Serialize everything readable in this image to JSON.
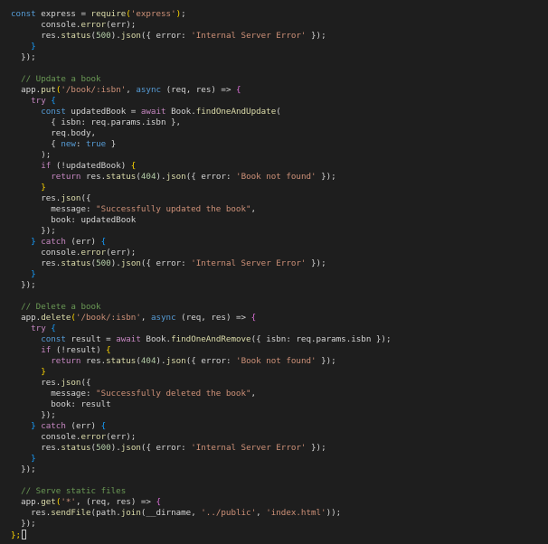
{
  "editor": {
    "lines": [
      [
        [
          "const",
          "kw"
        ],
        [
          " express = ",
          "txt"
        ],
        [
          "require",
          "fn"
        ],
        [
          "(",
          "br1"
        ],
        [
          "'express'",
          "str"
        ],
        [
          ")",
          "br1"
        ],
        [
          ";",
          "txt"
        ]
      ],
      [
        [
          "      console.",
          "txt"
        ],
        [
          "error",
          "fn"
        ],
        [
          "(err);",
          "txt"
        ]
      ],
      [
        [
          "      res.",
          "txt"
        ],
        [
          "status",
          "fn"
        ],
        [
          "(",
          "txt"
        ],
        [
          "500",
          "num"
        ],
        [
          ").",
          "txt"
        ],
        [
          "json",
          "fn"
        ],
        [
          "({ error: ",
          "txt"
        ],
        [
          "'Internal Server Error'",
          "str"
        ],
        [
          " });",
          "txt"
        ]
      ],
      [
        [
          "    }",
          "br3"
        ]
      ],
      [
        [
          "  });",
          "txt"
        ]
      ],
      [
        [
          "",
          "txt"
        ]
      ],
      [
        [
          "  // Update a book",
          "cmt"
        ]
      ],
      [
        [
          "  app.",
          "txt"
        ],
        [
          "put",
          "fn"
        ],
        [
          "(",
          "br1"
        ],
        [
          "'/book/:isbn'",
          "str"
        ],
        [
          ", ",
          "txt"
        ],
        [
          "async",
          "kw"
        ],
        [
          " (req, res) => ",
          "txt"
        ],
        [
          "{",
          "br2"
        ]
      ],
      [
        [
          "    ",
          "txt"
        ],
        [
          "try",
          "ctl"
        ],
        [
          " ",
          "txt"
        ],
        [
          "{",
          "br3"
        ]
      ],
      [
        [
          "      ",
          "txt"
        ],
        [
          "const",
          "kw"
        ],
        [
          " updatedBook = ",
          "txt"
        ],
        [
          "await",
          "ctl"
        ],
        [
          " Book.",
          "txt"
        ],
        [
          "findOneAndUpdate",
          "fn"
        ],
        [
          "(",
          "txt"
        ]
      ],
      [
        [
          "        { isbn: req.params.isbn },",
          "txt"
        ]
      ],
      [
        [
          "        req.body,",
          "txt"
        ]
      ],
      [
        [
          "        { ",
          "txt"
        ],
        [
          "new",
          "kw"
        ],
        [
          ": ",
          "txt"
        ],
        [
          "true",
          "kw"
        ],
        [
          " }",
          "txt"
        ]
      ],
      [
        [
          "      );",
          "txt"
        ]
      ],
      [
        [
          "      ",
          "txt"
        ],
        [
          "if",
          "ctl"
        ],
        [
          " (!updatedBook) ",
          "txt"
        ],
        [
          "{",
          "br1"
        ]
      ],
      [
        [
          "        ",
          "txt"
        ],
        [
          "return",
          "ctl"
        ],
        [
          " res.",
          "txt"
        ],
        [
          "status",
          "fn"
        ],
        [
          "(",
          "txt"
        ],
        [
          "404",
          "num"
        ],
        [
          ").",
          "txt"
        ],
        [
          "json",
          "fn"
        ],
        [
          "({ error: ",
          "txt"
        ],
        [
          "'Book not found'",
          "str"
        ],
        [
          " });",
          "txt"
        ]
      ],
      [
        [
          "      }",
          "br1"
        ]
      ],
      [
        [
          "      res.",
          "txt"
        ],
        [
          "json",
          "fn"
        ],
        [
          "({",
          "txt"
        ]
      ],
      [
        [
          "        message: ",
          "txt"
        ],
        [
          "\"Successfully updated the book\"",
          "str"
        ],
        [
          ",",
          "txt"
        ]
      ],
      [
        [
          "        book: updatedBook",
          "txt"
        ]
      ],
      [
        [
          "      });",
          "txt"
        ]
      ],
      [
        [
          "    } ",
          "br3"
        ],
        [
          "catch",
          "ctl"
        ],
        [
          " (err) ",
          "txt"
        ],
        [
          "{",
          "br3"
        ]
      ],
      [
        [
          "      console.",
          "txt"
        ],
        [
          "error",
          "fn"
        ],
        [
          "(err);",
          "txt"
        ]
      ],
      [
        [
          "      res.",
          "txt"
        ],
        [
          "status",
          "fn"
        ],
        [
          "(",
          "txt"
        ],
        [
          "500",
          "num"
        ],
        [
          ").",
          "txt"
        ],
        [
          "json",
          "fn"
        ],
        [
          "({ error: ",
          "txt"
        ],
        [
          "'Internal Server Error'",
          "str"
        ],
        [
          " });",
          "txt"
        ]
      ],
      [
        [
          "    }",
          "br3"
        ]
      ],
      [
        [
          "  });",
          "txt"
        ]
      ],
      [
        [
          "",
          "txt"
        ]
      ],
      [
        [
          "  // Delete a book",
          "cmt"
        ]
      ],
      [
        [
          "  app.",
          "txt"
        ],
        [
          "delete",
          "fn"
        ],
        [
          "(",
          "br1"
        ],
        [
          "'/book/:isbn'",
          "str"
        ],
        [
          ", ",
          "txt"
        ],
        [
          "async",
          "kw"
        ],
        [
          " (req, res) => ",
          "txt"
        ],
        [
          "{",
          "br2"
        ]
      ],
      [
        [
          "    ",
          "txt"
        ],
        [
          "try",
          "ctl"
        ],
        [
          " ",
          "txt"
        ],
        [
          "{",
          "br3"
        ]
      ],
      [
        [
          "      ",
          "txt"
        ],
        [
          "const",
          "kw"
        ],
        [
          " result = ",
          "txt"
        ],
        [
          "await",
          "ctl"
        ],
        [
          " Book.",
          "txt"
        ],
        [
          "findOneAndRemove",
          "fn"
        ],
        [
          "({ isbn: req.params.isbn });",
          "txt"
        ]
      ],
      [
        [
          "      ",
          "txt"
        ],
        [
          "if",
          "ctl"
        ],
        [
          " (!result) ",
          "txt"
        ],
        [
          "{",
          "br1"
        ]
      ],
      [
        [
          "        ",
          "txt"
        ],
        [
          "return",
          "ctl"
        ],
        [
          " res.",
          "txt"
        ],
        [
          "status",
          "fn"
        ],
        [
          "(",
          "txt"
        ],
        [
          "404",
          "num"
        ],
        [
          ").",
          "txt"
        ],
        [
          "json",
          "fn"
        ],
        [
          "({ error: ",
          "txt"
        ],
        [
          "'Book not found'",
          "str"
        ],
        [
          " });",
          "txt"
        ]
      ],
      [
        [
          "      }",
          "br1"
        ]
      ],
      [
        [
          "      res.",
          "txt"
        ],
        [
          "json",
          "fn"
        ],
        [
          "({",
          "txt"
        ]
      ],
      [
        [
          "        message: ",
          "txt"
        ],
        [
          "\"Successfully deleted the book\"",
          "str"
        ],
        [
          ",",
          "txt"
        ]
      ],
      [
        [
          "        book: result",
          "txt"
        ]
      ],
      [
        [
          "      });",
          "txt"
        ]
      ],
      [
        [
          "    } ",
          "br3"
        ],
        [
          "catch",
          "ctl"
        ],
        [
          " (err) ",
          "txt"
        ],
        [
          "{",
          "br3"
        ]
      ],
      [
        [
          "      console.",
          "txt"
        ],
        [
          "error",
          "fn"
        ],
        [
          "(err);",
          "txt"
        ]
      ],
      [
        [
          "      res.",
          "txt"
        ],
        [
          "status",
          "fn"
        ],
        [
          "(",
          "txt"
        ],
        [
          "500",
          "num"
        ],
        [
          ").",
          "txt"
        ],
        [
          "json",
          "fn"
        ],
        [
          "({ error: ",
          "txt"
        ],
        [
          "'Internal Server Error'",
          "str"
        ],
        [
          " });",
          "txt"
        ]
      ],
      [
        [
          "    }",
          "br3"
        ]
      ],
      [
        [
          "  });",
          "txt"
        ]
      ],
      [
        [
          "",
          "txt"
        ]
      ],
      [
        [
          "  // Serve static files",
          "cmt"
        ]
      ],
      [
        [
          "  app.",
          "txt"
        ],
        [
          "get",
          "fn"
        ],
        [
          "(",
          "br1"
        ],
        [
          "'*'",
          "str"
        ],
        [
          ", (req, res) => ",
          "txt"
        ],
        [
          "{",
          "br2"
        ]
      ],
      [
        [
          "    res.",
          "txt"
        ],
        [
          "sendFile",
          "fn"
        ],
        [
          "(path.",
          "txt"
        ],
        [
          "join",
          "fn"
        ],
        [
          "(__dirname, ",
          "txt"
        ],
        [
          "'../public'",
          "str"
        ],
        [
          ", ",
          "txt"
        ],
        [
          "'index.html'",
          "str"
        ],
        [
          "));",
          "txt"
        ]
      ],
      [
        [
          "  });",
          "txt"
        ]
      ],
      [
        [
          "};",
          "br1"
        ]
      ]
    ]
  },
  "colors": {
    "background": "#1e1e1e",
    "keyword": "#569cd6",
    "control": "#c586c0",
    "function": "#dcdcaa",
    "string": "#ce9178",
    "number": "#b5cea8",
    "comment": "#6a9955",
    "text": "#d4d4d4"
  }
}
